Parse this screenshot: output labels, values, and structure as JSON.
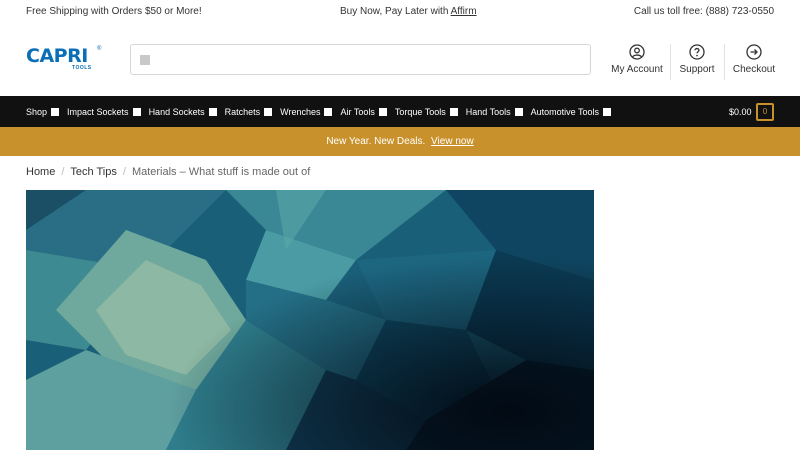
{
  "topbar": {
    "shipping": "Free Shipping with Orders $50 or More!",
    "bnpl_text": "Buy Now, Pay Later with",
    "bnpl_link": "Affirm",
    "phone": "Call us toll free: (888) 723-0550"
  },
  "logo": {
    "word": "CAPRI",
    "sub": "TOOLS",
    "reg": "®"
  },
  "header_nav": {
    "account": "My Account",
    "support": "Support",
    "checkout": "Checkout"
  },
  "nav": {
    "items": [
      "Shop",
      "Impact Sockets",
      "Hand Sockets",
      "Ratchets",
      "Wrenches",
      "Air Tools",
      "Torque Tools",
      "Hand Tools",
      "Automotive Tools"
    ],
    "cart_total": "$0.00",
    "cart_count": "0"
  },
  "promo": {
    "text": "New Year. New Deals.",
    "link": "View now"
  },
  "breadcrumb": {
    "home": "Home",
    "category": "Tech Tips",
    "current": "Materials – What stuff is made out of"
  },
  "colors": {
    "brand_blue": "#0b6fb8",
    "nav_bg": "#111111",
    "accent_gold": "#c8912b"
  }
}
